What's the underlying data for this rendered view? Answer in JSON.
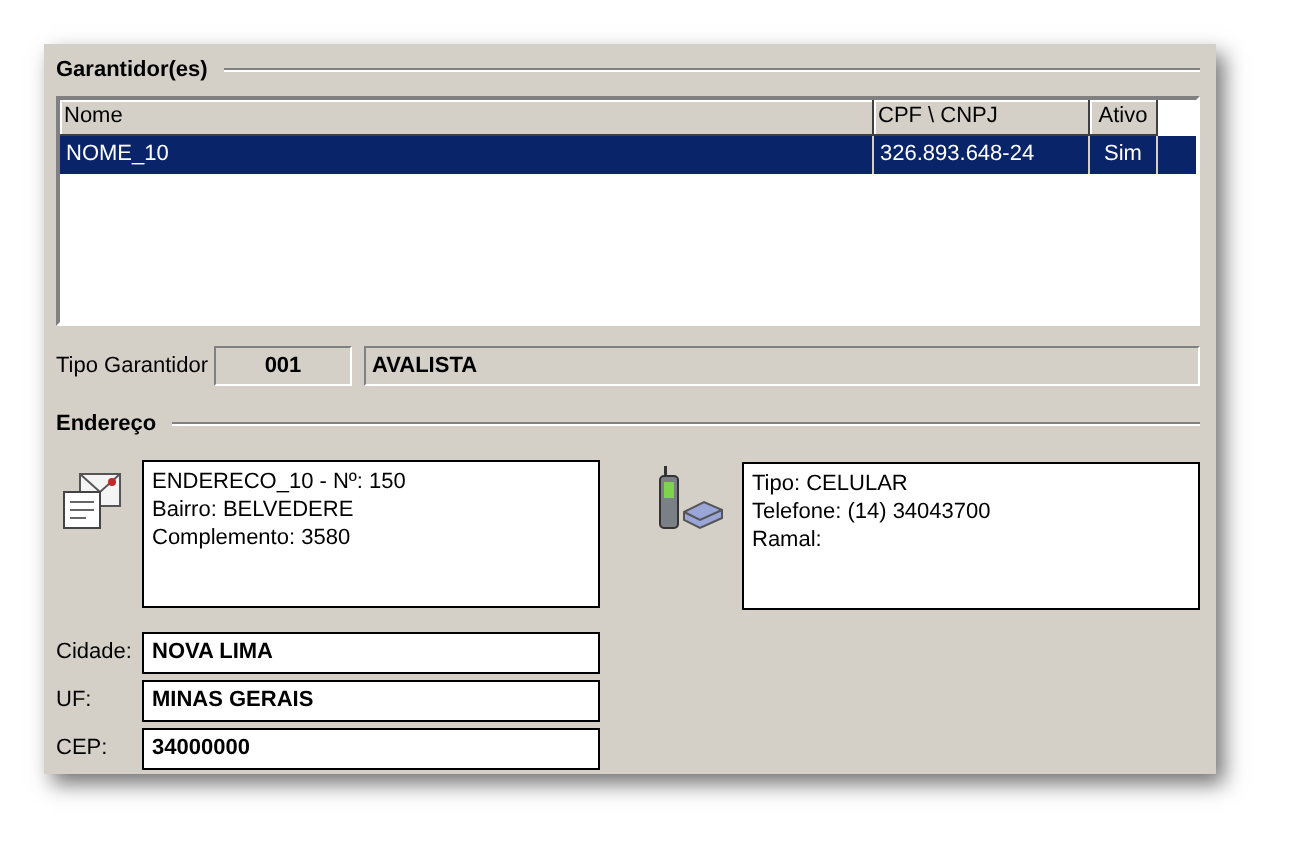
{
  "garantidores": {
    "title": "Garantidor(es)",
    "table": {
      "columns": [
        "Nome",
        "CPF \\ CNPJ",
        "Ativo"
      ],
      "rows": [
        {
          "cells": [
            "NOME_10",
            "326.893.648-24",
            "Sim"
          ],
          "selected": true
        }
      ]
    },
    "tipo": {
      "label": "Tipo Garantidor",
      "code": "001",
      "description": "AVALISTA"
    }
  },
  "endereco": {
    "title": "Endereço",
    "address_lines": [
      "ENDERECO_10 - Nº: 150",
      "Bairro: BELVEDERE",
      "Complemento: 3580"
    ],
    "phone_lines": [
      "Tipo: CELULAR",
      "Telefone: (14)  34043700",
      "Ramal:"
    ],
    "fields": [
      {
        "label": "Cidade:",
        "value": "NOVA LIMA"
      },
      {
        "label": "UF:",
        "value": "MINAS GERAIS"
      },
      {
        "label": "CEP:",
        "value": "34000000"
      }
    ]
  }
}
